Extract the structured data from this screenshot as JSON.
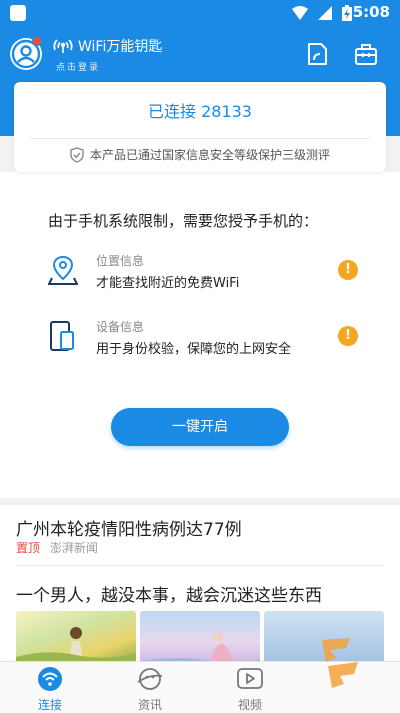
{
  "status_bar": {
    "time": "5:08",
    "icons": [
      "notification-icon",
      "wifi-icon",
      "signal-icon",
      "battery-charging-icon"
    ]
  },
  "header": {
    "app_title": "WiFi万能钥匙",
    "login_prompt": "点击登录",
    "buttons": [
      "scan-icon",
      "toolbox-icon"
    ]
  },
  "connection": {
    "status": "已连接 28133",
    "certification": "本产品已通过国家信息安全等级保护三级测评"
  },
  "permissions": {
    "title": "由于手机系统限制，需要您授予手机的：",
    "items": [
      {
        "name": "位置信息",
        "desc": "才能查找附近的免费WiFi",
        "icon": "location-icon",
        "warn": "!"
      },
      {
        "name": "设备信息",
        "desc": "用于身份校验，保障您的上网安全",
        "icon": "device-icon",
        "warn": "!"
      }
    ],
    "button_label": "一键开启"
  },
  "news": {
    "items": [
      {
        "title": "广州本轮疫情阳性病例达77例",
        "tag": "置顶",
        "source": "澎湃新闻"
      },
      {
        "title": "一个男人，越没本事，越会沉迷这些东西"
      }
    ]
  },
  "nav": {
    "items": [
      {
        "label": "连接",
        "icon": "wifi-icon",
        "active": true
      },
      {
        "label": "资讯",
        "icon": "planet-icon",
        "active": false
      },
      {
        "label": "视频",
        "icon": "video-icon",
        "active": false
      },
      {
        "label": "",
        "icon": "",
        "active": false
      }
    ]
  },
  "colors": {
    "primary": "#1a8ae5",
    "warning": "#f5a623",
    "top_tag": "#e8493b"
  }
}
